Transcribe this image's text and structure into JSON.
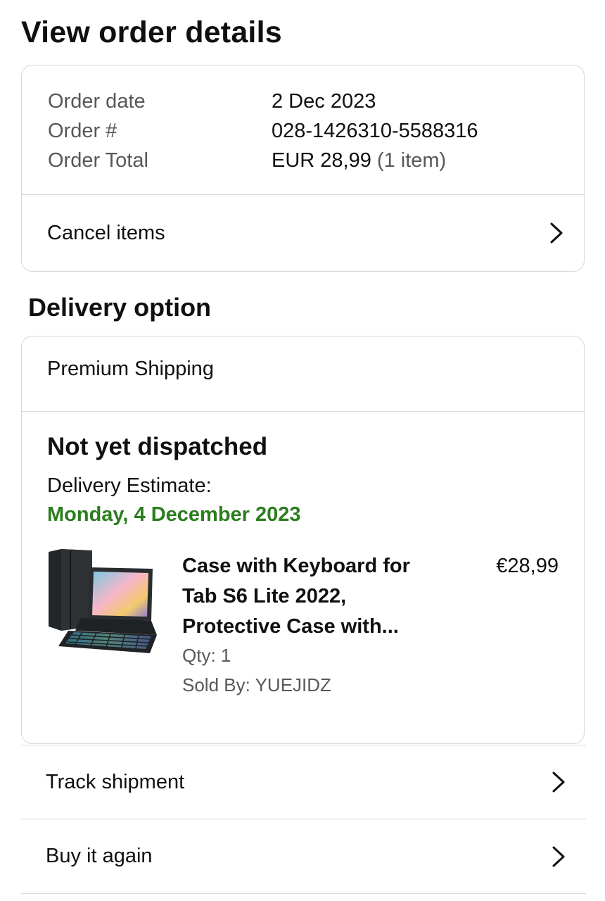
{
  "page": {
    "title": "View order details"
  },
  "summary": {
    "order_date_label": "Order date",
    "order_date_value": "2 Dec 2023",
    "order_number_label": "Order #",
    "order_number_value": "028-1426310-5588316",
    "order_total_label": "Order Total",
    "order_total_value": "EUR 28,99",
    "order_total_count": "(1 item)",
    "cancel_label": "Cancel items"
  },
  "delivery": {
    "section_title": "Delivery option",
    "shipping_method": "Premium Shipping",
    "status": "Not yet dispatched",
    "estimate_label": "Delivery Estimate:",
    "estimate_date": "Monday, 4 December 2023",
    "estimate_color": "#2c7d1f"
  },
  "item": {
    "title": "Case with Keyboard for Tab S6 Lite 2022, Protective Case with...",
    "price": "€28,99",
    "qty": "Qty: 1",
    "seller": "Sold By: YUEJIDZ",
    "image_icon": "tablet-keyboard-case-image"
  },
  "actions": {
    "track_label": "Track shipment",
    "buy_again_label": "Buy it again"
  }
}
